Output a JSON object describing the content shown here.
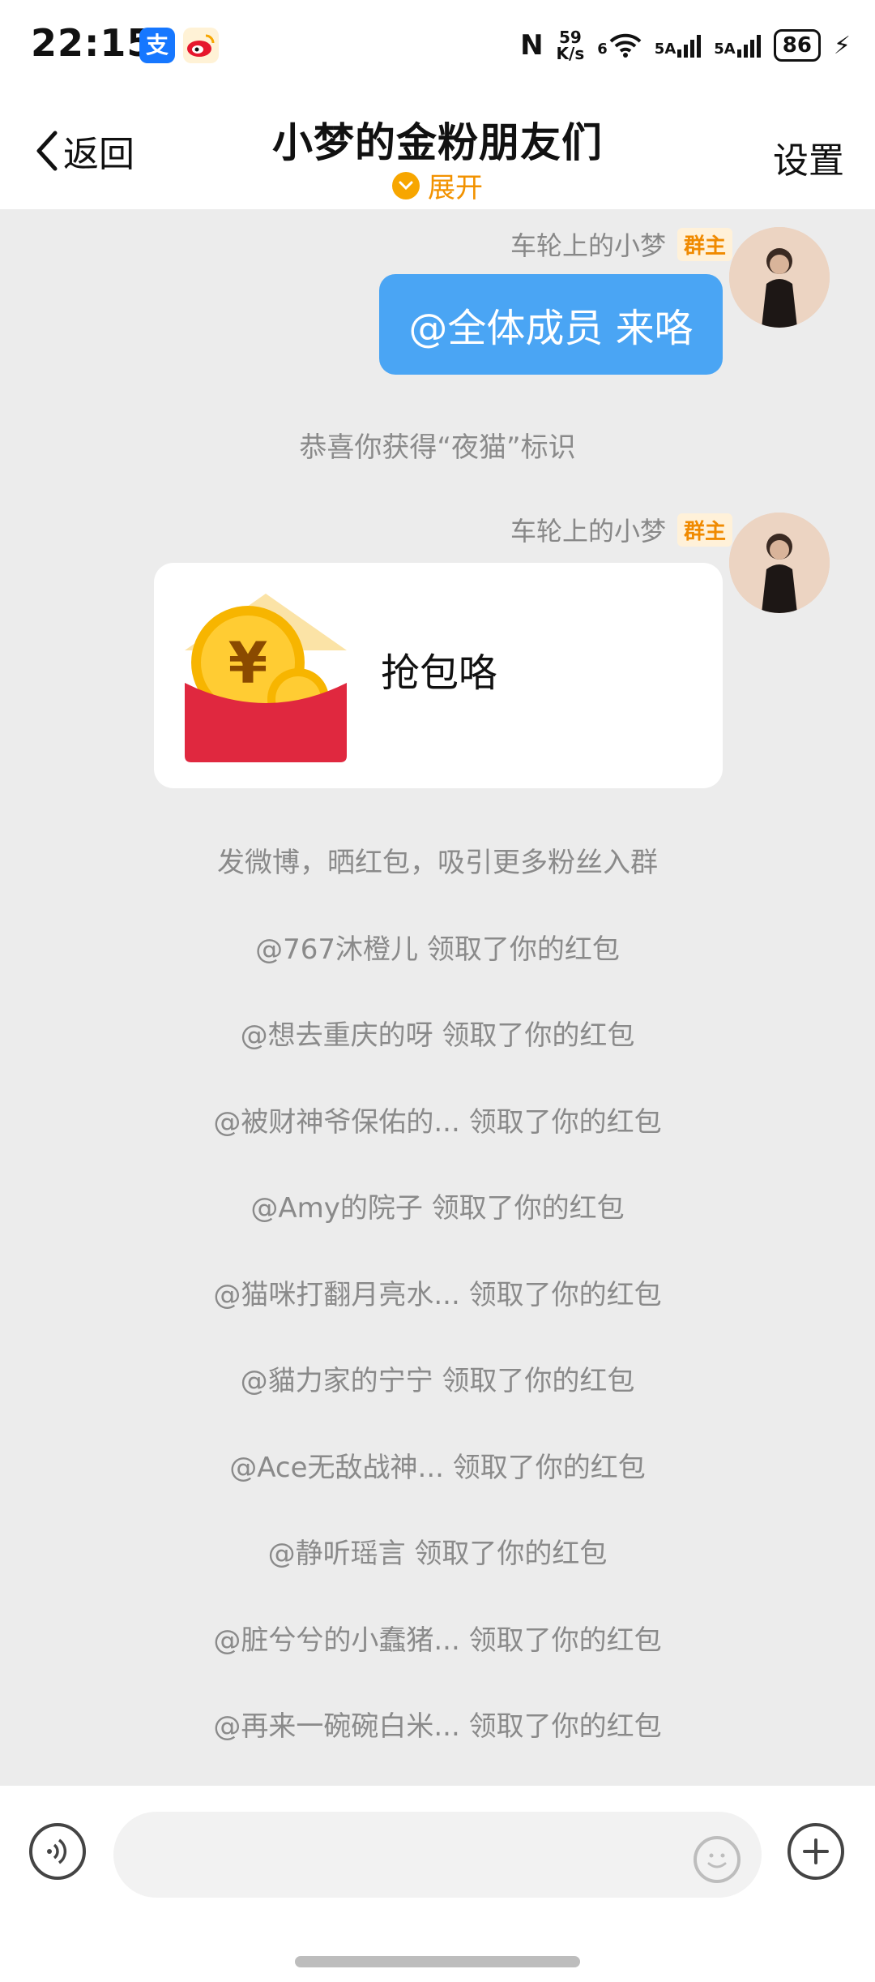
{
  "status_bar": {
    "time": "22:15",
    "network_speed_top": "59",
    "network_speed_unit": "K/s",
    "wifi_badge": "6",
    "signal1_label": "5A",
    "signal2_label": "5A",
    "battery_percent": "86",
    "alipay_glyph": "支"
  },
  "header": {
    "back_label": "返回",
    "title": "小梦的金粉朋友们",
    "expand_label": "展开",
    "settings_label": "设置"
  },
  "chat": {
    "message1": {
      "sender": "车轮上的小梦",
      "badge": "群主",
      "text": "@全体成员 来咯"
    },
    "system_notice": "恭喜你获得“夜猫”标识",
    "message2": {
      "sender": "车轮上的小梦",
      "badge": "群主",
      "redpacket_text": "抢包咯"
    },
    "promo_notice": "发微博，晒红包，吸引更多粉丝入群",
    "claims": [
      "@767沐橙儿 领取了你的红包",
      "@想去重庆的呀 领取了你的红包",
      "@被财神爷保佑的... 领取了你的红包",
      "@Amy的院子 领取了你的红包",
      "@猫咪打翻月亮水... 领取了你的红包",
      "@貓力家的宁宁 领取了你的红包",
      "@Ace无敌战神... 领取了你的红包",
      "@静听瑶言 领取了你的红包",
      "@脏兮兮的小蠢猪... 领取了你的红包",
      "@再来一碗碗白米... 领取了你的红包"
    ]
  },
  "input_bar": {
    "placeholder": ""
  },
  "colors": {
    "accent_blue": "#4aa5f4",
    "owner_orange": "#f08a00",
    "expand_orange": "#f29200",
    "redpacket_red": "#e0283f",
    "coin_gold": "#f7b500"
  },
  "icons": [
    "alipay-icon",
    "weibo-icon",
    "nfc-icon",
    "wifi-icon",
    "signal-icon",
    "battery-icon",
    "back-chevron-icon",
    "expand-chevron-icon",
    "redpacket-icon",
    "voice-icon",
    "emoji-icon",
    "plus-icon"
  ]
}
